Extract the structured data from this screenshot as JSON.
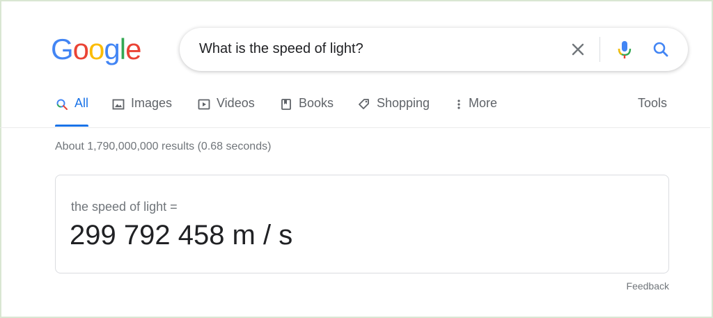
{
  "logo": {
    "letters": [
      "G",
      "o",
      "o",
      "g",
      "l",
      "e"
    ],
    "colors": [
      "#4285F4",
      "#EA4335",
      "#FBBC05",
      "#4285F4",
      "#34A853",
      "#EA4335"
    ]
  },
  "search": {
    "query": "What is the speed of light?",
    "clear_icon": "close-icon",
    "mic_icon": "mic-icon",
    "search_icon": "search-icon"
  },
  "tabs": [
    {
      "label": "All",
      "icon": "search-icon",
      "active": true
    },
    {
      "label": "Images",
      "icon": "image-icon"
    },
    {
      "label": "Videos",
      "icon": "play-icon"
    },
    {
      "label": "Books",
      "icon": "book-icon"
    },
    {
      "label": "Shopping",
      "icon": "tag-icon"
    },
    {
      "label": "More",
      "icon": "more-vert-icon"
    }
  ],
  "tools_label": "Tools",
  "result_stats": "About 1,790,000,000 results (0.68 seconds)",
  "answer": {
    "label": "the speed of light =",
    "value": "299 792 458 m / s"
  },
  "feedback_label": "Feedback",
  "colors": {
    "accent": "#1a73e8",
    "text": "#202124",
    "muted": "#70757a"
  }
}
